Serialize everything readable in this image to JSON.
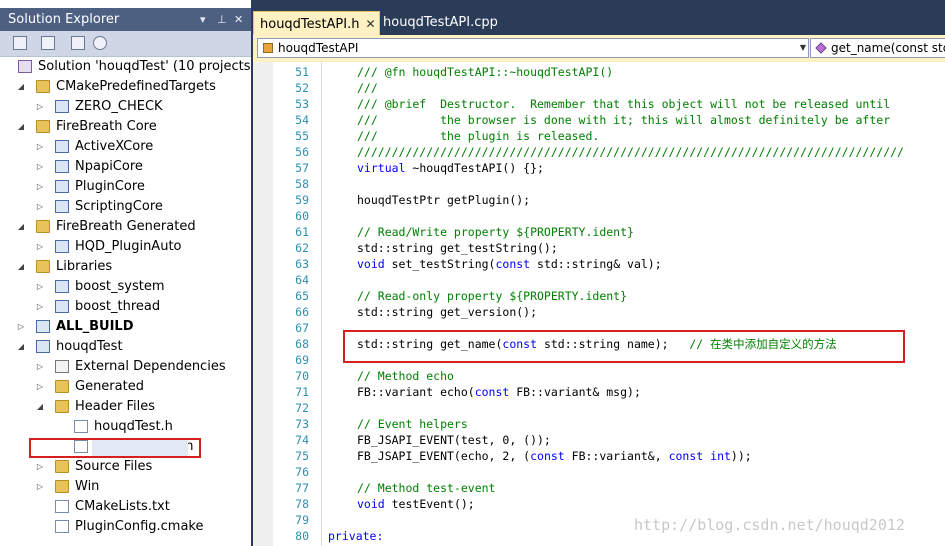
{
  "solution_explorer": {
    "title": "Solution Explorer",
    "title_buttons": [
      "▾",
      "⊥",
      "✕"
    ],
    "toolbar_icons": [
      "properties-icon",
      "show-all-files-icon",
      "refresh-icon",
      "view-class-diagram-icon"
    ],
    "items": [
      {
        "label": "Solution 'houqdTest' (10 projects)",
        "icon": "solution-icon",
        "level": 0,
        "expand": "",
        "bold": false
      },
      {
        "label": "CMakePredefinedTargets",
        "icon": "folder-icon",
        "level": 1,
        "expand": "open",
        "bold": false
      },
      {
        "label": "ZERO_CHECK",
        "icon": "project-icon",
        "level": 2,
        "expand": "closed",
        "bold": false
      },
      {
        "label": "FireBreath Core",
        "icon": "folder-icon",
        "level": 1,
        "expand": "open",
        "bold": false
      },
      {
        "label": "ActiveXCore",
        "icon": "project-icon",
        "level": 2,
        "expand": "closed",
        "bold": false
      },
      {
        "label": "NpapiCore",
        "icon": "project-icon",
        "level": 2,
        "expand": "closed",
        "bold": false
      },
      {
        "label": "PluginCore",
        "icon": "project-icon",
        "level": 2,
        "expand": "closed",
        "bold": false
      },
      {
        "label": "ScriptingCore",
        "icon": "project-icon",
        "level": 2,
        "expand": "closed",
        "bold": false
      },
      {
        "label": "FireBreath Generated",
        "icon": "folder-icon",
        "level": 1,
        "expand": "open",
        "bold": false
      },
      {
        "label": "HQD_PluginAuto",
        "icon": "project-icon",
        "level": 2,
        "expand": "closed",
        "bold": false
      },
      {
        "label": "Libraries",
        "icon": "folder-icon",
        "level": 1,
        "expand": "open",
        "bold": false
      },
      {
        "label": "boost_system",
        "icon": "project-icon",
        "level": 2,
        "expand": "closed",
        "bold": false
      },
      {
        "label": "boost_thread",
        "icon": "project-icon",
        "level": 2,
        "expand": "closed",
        "bold": false
      },
      {
        "label": "ALL_BUILD",
        "icon": "project-icon",
        "level": 1,
        "expand": "closed",
        "bold": true
      },
      {
        "label": "houqdTest",
        "icon": "project-icon",
        "level": 1,
        "expand": "open",
        "bold": false
      },
      {
        "label": "External Dependencies",
        "icon": "dependencies-icon",
        "level": 2,
        "expand": "closed",
        "bold": false
      },
      {
        "label": "Generated",
        "icon": "folder-icon",
        "level": 2,
        "expand": "closed",
        "bold": false
      },
      {
        "label": "Header Files",
        "icon": "folder-icon",
        "level": 2,
        "expand": "open",
        "bold": false
      },
      {
        "label": "houqdTest.h",
        "icon": "header-file-icon",
        "level": 3,
        "expand": "",
        "bold": false
      },
      {
        "label": "houqdTestAPI.h",
        "icon": "header-file-icon",
        "level": 3,
        "expand": "",
        "bold": false,
        "selected": true
      },
      {
        "label": "Source Files",
        "icon": "folder-icon",
        "level": 2,
        "expand": "closed",
        "bold": false
      },
      {
        "label": "Win",
        "icon": "folder-icon",
        "level": 2,
        "expand": "closed",
        "bold": false
      },
      {
        "label": "CMakeLists.txt",
        "icon": "text-file-icon",
        "level": 2,
        "expand": "",
        "bold": false
      },
      {
        "label": "PluginConfig.cmake",
        "icon": "text-file-icon",
        "level": 2,
        "expand": "",
        "bold": false
      }
    ]
  },
  "editor": {
    "tabs": [
      {
        "label": "houqdTestAPI.h",
        "active": true,
        "close": "✕"
      },
      {
        "label": "houqdTestAPI.cpp",
        "active": false,
        "close": ""
      }
    ],
    "scope_combo": "houqdTestAPI",
    "member_combo": "get_name(const std",
    "lines": [
      {
        "n": "51",
        "segs": [
          {
            "t": "/// @fn houqdTestAPI::~houqdTestAPI()",
            "c": "cm"
          }
        ]
      },
      {
        "n": "52",
        "segs": [
          {
            "t": "///",
            "c": "cm"
          }
        ]
      },
      {
        "n": "53",
        "segs": [
          {
            "t": "/// @brief  Destructor.  Remember that this object will not be released until",
            "c": "cm"
          }
        ]
      },
      {
        "n": "54",
        "segs": [
          {
            "t": "///         the browser is done with it; this will almost definitely be after",
            "c": "cm"
          }
        ]
      },
      {
        "n": "55",
        "segs": [
          {
            "t": "///         the plugin is released.",
            "c": "cm"
          }
        ]
      },
      {
        "n": "56",
        "segs": [
          {
            "t": "///////////////////////////////////////////////////////////////////////////////",
            "c": "cm"
          }
        ]
      },
      {
        "n": "57",
        "segs": [
          {
            "t": "virtual",
            "c": "kw"
          },
          {
            "t": " ~houqdTestAPI() {};",
            "c": ""
          }
        ]
      },
      {
        "n": "58",
        "segs": []
      },
      {
        "n": "59",
        "segs": [
          {
            "t": "houqdTestPtr getPlugin();",
            "c": ""
          }
        ]
      },
      {
        "n": "60",
        "segs": []
      },
      {
        "n": "61",
        "segs": [
          {
            "t": "// Read/Write property ${PROPERTY.ident}",
            "c": "cm"
          }
        ]
      },
      {
        "n": "62",
        "segs": [
          {
            "t": "std::string get_testString();",
            "c": ""
          }
        ]
      },
      {
        "n": "63",
        "segs": [
          {
            "t": "void",
            "c": "kw"
          },
          {
            "t": " set_testString(",
            "c": ""
          },
          {
            "t": "const",
            "c": "kw"
          },
          {
            "t": " std::string& val);",
            "c": ""
          }
        ]
      },
      {
        "n": "64",
        "segs": []
      },
      {
        "n": "65",
        "segs": [
          {
            "t": "// Read-only property ${PROPERTY.ident}",
            "c": "cm"
          }
        ]
      },
      {
        "n": "66",
        "segs": [
          {
            "t": "std::string get_version();",
            "c": ""
          }
        ]
      },
      {
        "n": "67",
        "segs": []
      },
      {
        "n": "68",
        "segs": [
          {
            "t": "std::string get_name(",
            "c": ""
          },
          {
            "t": "const",
            "c": "kw"
          },
          {
            "t": " std::string name);   ",
            "c": ""
          },
          {
            "t": "// 在类中添加自定义的方法",
            "c": "cm"
          }
        ]
      },
      {
        "n": "69",
        "segs": []
      },
      {
        "n": "70",
        "segs": [
          {
            "t": "// Method echo",
            "c": "cm"
          }
        ]
      },
      {
        "n": "71",
        "segs": [
          {
            "t": "FB::variant echo(",
            "c": ""
          },
          {
            "t": "const",
            "c": "kw"
          },
          {
            "t": " FB::variant& msg);",
            "c": ""
          }
        ]
      },
      {
        "n": "72",
        "segs": []
      },
      {
        "n": "73",
        "segs": [
          {
            "t": "// Event helpers",
            "c": "cm"
          }
        ]
      },
      {
        "n": "74",
        "segs": [
          {
            "t": "FB_JSAPI_EVENT(test, 0, ());",
            "c": ""
          }
        ]
      },
      {
        "n": "75",
        "segs": [
          {
            "t": "FB_JSAPI_EVENT(echo, 2, (",
            "c": ""
          },
          {
            "t": "const",
            "c": "kw"
          },
          {
            "t": " FB::variant&, ",
            "c": ""
          },
          {
            "t": "const",
            "c": "kw"
          },
          {
            "t": " ",
            "c": ""
          },
          {
            "t": "int",
            "c": "kw"
          },
          {
            "t": "));",
            "c": ""
          }
        ]
      },
      {
        "n": "76",
        "segs": []
      },
      {
        "n": "77",
        "segs": [
          {
            "t": "// Method test-event",
            "c": "cm"
          }
        ]
      },
      {
        "n": "78",
        "segs": [
          {
            "t": "void",
            "c": "kw"
          },
          {
            "t": " testEvent();",
            "c": ""
          }
        ]
      },
      {
        "n": "79",
        "segs": []
      },
      {
        "n": "80",
        "segs": [
          {
            "t": "private:",
            "c": "kw",
            "outdent": true
          }
        ]
      }
    ],
    "watermark": "http://blog.csdn.net/houqd2012"
  },
  "colors": {
    "frame": "#2b3c59",
    "title_bar": "#4d6082",
    "active_tab": "#fff1c2",
    "keyword": "#0000ff",
    "comment": "#008000",
    "line_number": "#2b91af",
    "highlight_box": "#d62020"
  }
}
